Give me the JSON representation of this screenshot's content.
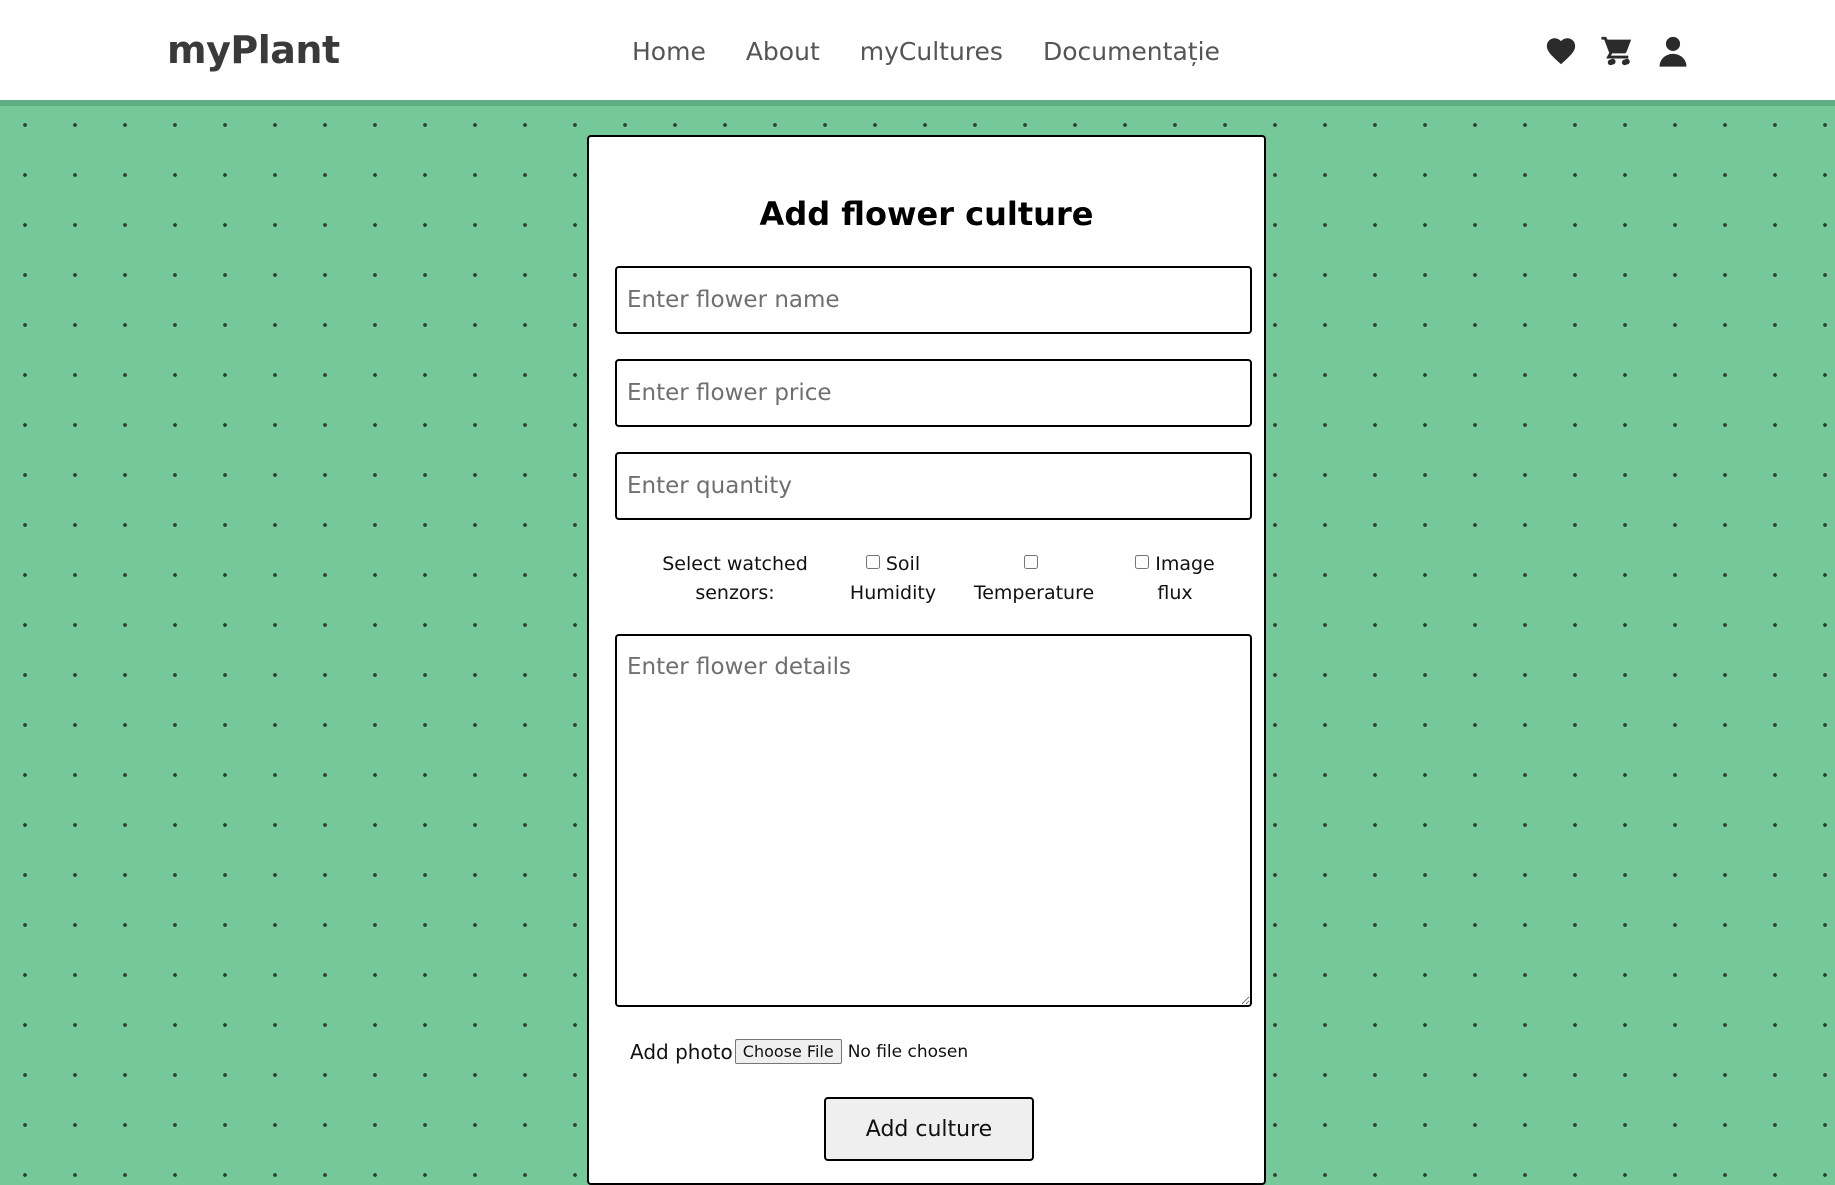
{
  "header": {
    "logo": "myPlant",
    "nav": [
      {
        "label": "Home"
      },
      {
        "label": "About"
      },
      {
        "label": "myCultures"
      },
      {
        "label": "Documentație"
      }
    ],
    "icons": [
      "heart-icon",
      "cart-icon",
      "user-icon"
    ]
  },
  "form": {
    "title": "Add flower culture",
    "name_placeholder": "Enter flower name",
    "price_placeholder": "Enter flower price",
    "quantity_placeholder": "Enter quantity",
    "sensors_label": "Select watched senzors:",
    "sensors": [
      {
        "label": "Soil Humidity",
        "checked": false
      },
      {
        "label": "Temperature",
        "checked": false
      },
      {
        "label": "Image flux",
        "checked": false
      }
    ],
    "details_placeholder": "Enter flower details",
    "photo_label": "Add photo",
    "choose_file_label": "Choose File",
    "file_status": "No file chosen",
    "submit_label": "Add culture"
  },
  "colors": {
    "background": "#75c89a",
    "nav_border": "#5fae84",
    "dot": "#2f3b33"
  }
}
